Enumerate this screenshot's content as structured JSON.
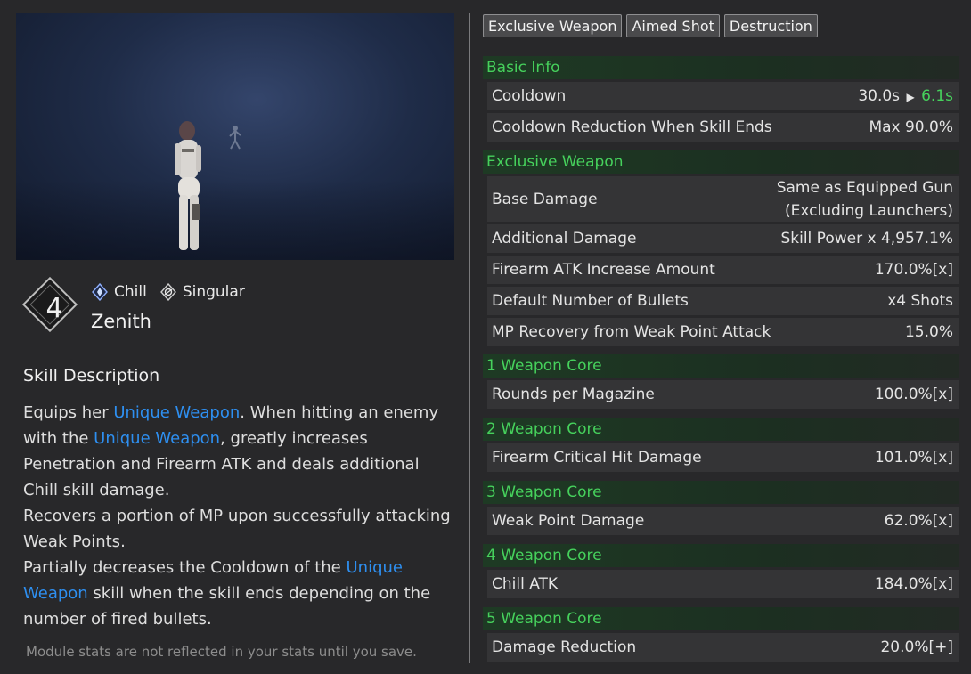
{
  "skill": {
    "level": "4",
    "element": "Chill",
    "type": "Singular",
    "name": "Zenith"
  },
  "description": {
    "title": "Skill Description",
    "p1_a": "Equips her ",
    "kw1": "Unique Weapon",
    "p1_b": ". When hitting an enemy with the ",
    "kw2": "Unique Weapon",
    "p1_c": ", greatly increases Penetration and Firearm ATK and deals additional Chill skill damage.",
    "p2": "Recovers a portion of MP upon successfully attacking Weak Points.",
    "p3_a": "Partially decreases the Cooldown of the ",
    "kw3": "Unique Weapon",
    "p3_b": " skill when the skill ends depending on the number of fired bullets."
  },
  "footnote": "Module stats are not reflected in your stats until you save.",
  "tabs": [
    "Exclusive Weapon",
    "Aimed Shot",
    "Destruction"
  ],
  "sections": {
    "basic_info": "Basic Info",
    "exclusive_weapon": "Exclusive Weapon",
    "core1": "1 Weapon Core",
    "core2": "2 Weapon Core",
    "core3": "3 Weapon Core",
    "core4": "4 Weapon Core",
    "core5": "5 Weapon Core"
  },
  "stats": {
    "cooldown": {
      "label": "Cooldown",
      "base": "30.0s",
      "arrow": "▶",
      "new": "6.1s"
    },
    "cdr_end": {
      "label": "Cooldown Reduction When Skill Ends",
      "value": "Max 90.0%"
    },
    "base_damage": {
      "label": "Base Damage",
      "value": "Same as Equipped Gun (Excluding Launchers)"
    },
    "additional_damage": {
      "label": "Additional Damage",
      "value": "Skill Power x 4,957.1%"
    },
    "firearm_atk": {
      "label": "Firearm ATK Increase Amount",
      "value": "170.0%[x]"
    },
    "bullets": {
      "label": "Default Number of Bullets",
      "value": "x4 Shots"
    },
    "mp_recovery": {
      "label": "MP Recovery from Weak Point Attack",
      "value": "15.0%"
    },
    "rounds": {
      "label": "Rounds per Magazine",
      "value": "100.0%[x]"
    },
    "crit": {
      "label": "Firearm Critical Hit Damage",
      "value": "101.0%[x]"
    },
    "weak_point": {
      "label": "Weak Point Damage",
      "value": "62.0%[x]"
    },
    "chill_atk": {
      "label": "Chill ATK",
      "value": "184.0%[x]"
    },
    "dmg_reduction": {
      "label": "Damage Reduction",
      "value": "20.0%[+]"
    }
  },
  "colors": {
    "accent_green": "#46d15c",
    "keyword_blue": "#2e8ff0",
    "section_bg": "#1e3a24",
    "row_bg": "#343436"
  }
}
